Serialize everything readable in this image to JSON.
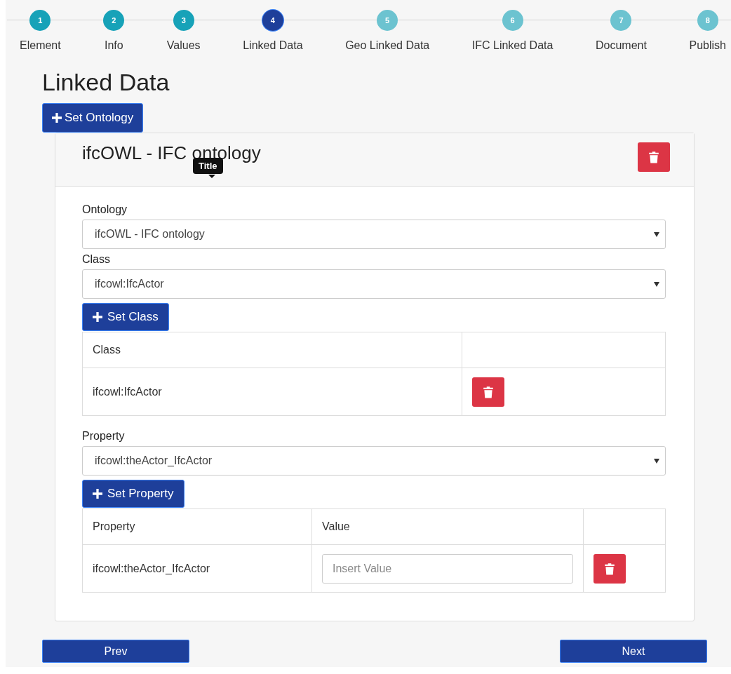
{
  "steps": [
    {
      "number": "1",
      "label": "Element",
      "completed": true,
      "selected": false
    },
    {
      "number": "2",
      "label": "Info",
      "completed": true,
      "selected": false
    },
    {
      "number": "3",
      "label": "Values",
      "completed": true,
      "selected": false
    },
    {
      "number": "4",
      "label": "Linked Data",
      "completed": false,
      "selected": true
    },
    {
      "number": "5",
      "label": "Geo Linked Data",
      "completed": false,
      "selected": false
    },
    {
      "number": "6",
      "label": "IFC Linked Data",
      "completed": false,
      "selected": false
    },
    {
      "number": "7",
      "label": "Document",
      "completed": false,
      "selected": false
    },
    {
      "number": "8",
      "label": "Publish",
      "completed": false,
      "selected": false
    }
  ],
  "heading": "Linked Data",
  "set_ontology_button": "Set Ontology",
  "ontology_card": {
    "title": "ifcOWL - IFC ontology",
    "tooltip": "Title",
    "ontology": {
      "label": "Ontology",
      "value": "ifcOWL - IFC ontology"
    },
    "class": {
      "label": "Class",
      "value": "ifcowl:IfcActor"
    },
    "set_class_button": "Set Class",
    "class_table": {
      "columns": [
        "Class"
      ],
      "rows": [
        {
          "class": "ifcowl:IfcActor"
        }
      ]
    },
    "property": {
      "label": "Property",
      "value": "ifcowl:theActor_IfcActor"
    },
    "set_property_button": "Set Property",
    "property_table": {
      "columns": [
        "Property",
        "Value"
      ],
      "rows": [
        {
          "property": "ifcowl:theActor_IfcActor",
          "value_placeholder": "Insert Value"
        }
      ]
    }
  },
  "nav": {
    "prev": "Prev",
    "next": "Next"
  }
}
